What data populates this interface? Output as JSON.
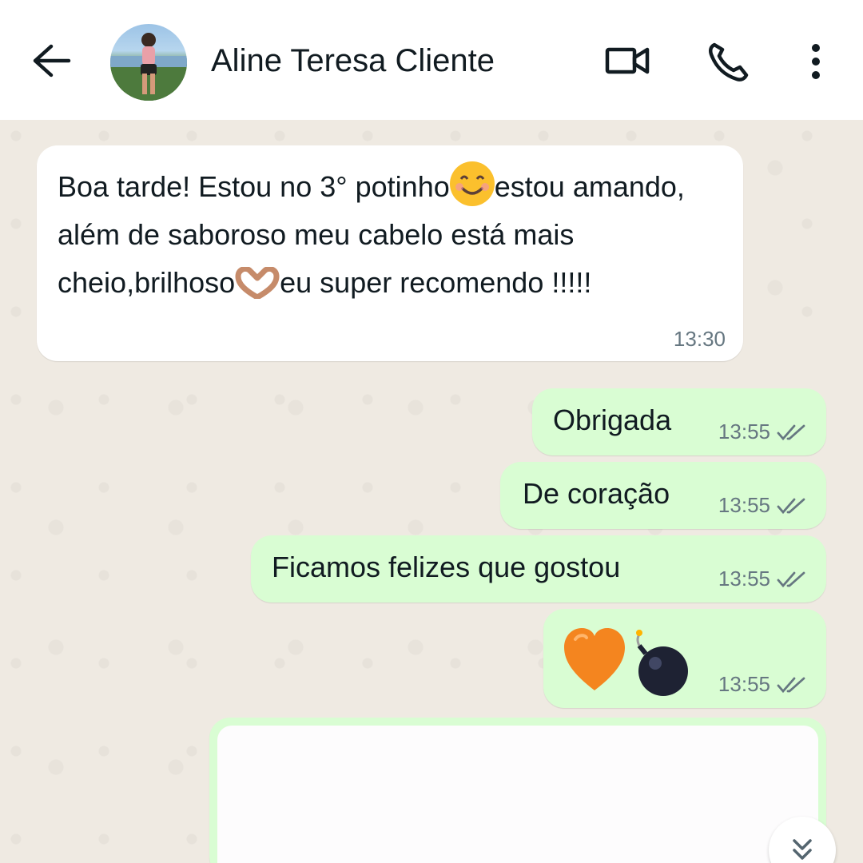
{
  "header": {
    "contact_name": "Aline Teresa Cliente"
  },
  "messages": [
    {
      "direction": "incoming",
      "text_parts": [
        "Boa tarde! Estou no 3° potinho",
        "estou amando, além de saboroso meu cabelo está mais cheio,brilhoso",
        "eu super recomendo !!!!!"
      ],
      "time": "13:30"
    },
    {
      "direction": "outgoing",
      "text": "Obrigada",
      "time": "13:55",
      "status": "read"
    },
    {
      "direction": "outgoing",
      "text": "De coração",
      "time": "13:55",
      "status": "read"
    },
    {
      "direction": "outgoing",
      "text": "Ficamos felizes que gostou",
      "time": "13:55",
      "status": "read"
    },
    {
      "direction": "outgoing",
      "emojis": [
        "orange-heart",
        "bomb"
      ],
      "time": "13:55",
      "status": "read"
    }
  ],
  "colors": {
    "incoming_bubble": "#ffffff",
    "outgoing_bubble": "#d9fdd3",
    "chat_background": "#efeae2",
    "read_ticks": "#667781"
  },
  "icons": [
    "back-arrow-icon",
    "video-call-icon",
    "phone-icon",
    "more-vert-icon",
    "chevron-double-down-icon"
  ]
}
